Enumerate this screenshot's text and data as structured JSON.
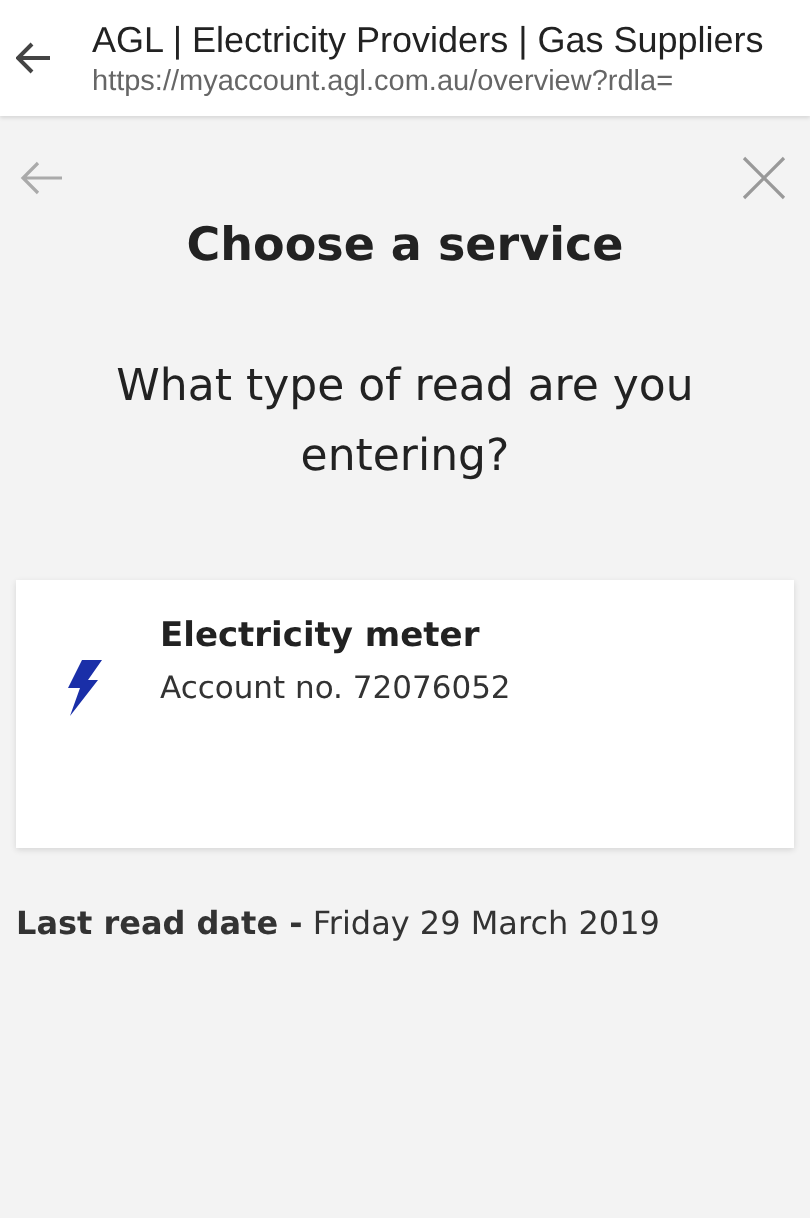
{
  "browser_bar": {
    "title": "AGL | Electricity Providers | Gas Suppliers",
    "url": "https://myaccount.agl.com.au/overview?rdla="
  },
  "heading": "Choose a service",
  "question": "What type of read are you entering?",
  "services": [
    {
      "kind": "electricity",
      "name": "Electricity meter",
      "account": "Account no. 72076052"
    }
  ],
  "last_read": "**Last read date -** Friday 29 March 2019"
}
